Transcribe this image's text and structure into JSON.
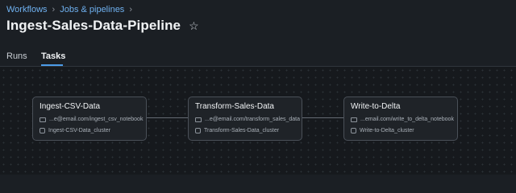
{
  "breadcrumb": [
    {
      "label": "Workflows"
    },
    {
      "label": "Jobs & pipelines"
    }
  ],
  "breadcrumb_separator": "›",
  "title": "Ingest-Sales-Data-Pipeline",
  "favorite_icon": "star-icon",
  "tabs": [
    {
      "label": "Runs",
      "active": false
    },
    {
      "label": "Tasks",
      "active": true
    }
  ],
  "colors": {
    "background": "#1b1f24",
    "link": "#6fb1f0",
    "tab_accent": "#4c9be8",
    "node_border": "#4a5058"
  },
  "tasks": [
    {
      "name": "Ingest-CSV-Data",
      "notebook": "...e@email.com/ingest_csv_notebook",
      "notebook_icon": "folder-icon",
      "cluster": "Ingest-CSV-Data_cluster",
      "cluster_icon": "cluster-icon"
    },
    {
      "name": "Transform-Sales-Data",
      "notebook": "...e@email.com/transform_sales_data",
      "notebook_icon": "folder-icon",
      "cluster": "Transform-Sales-Data_cluster",
      "cluster_icon": "cluster-icon"
    },
    {
      "name": "Write-to-Delta",
      "notebook": "...email.com/write_to_delta_notebook",
      "notebook_icon": "folder-icon",
      "cluster": "Write-to-Delta_cluster",
      "cluster_icon": "cluster-icon"
    }
  ]
}
